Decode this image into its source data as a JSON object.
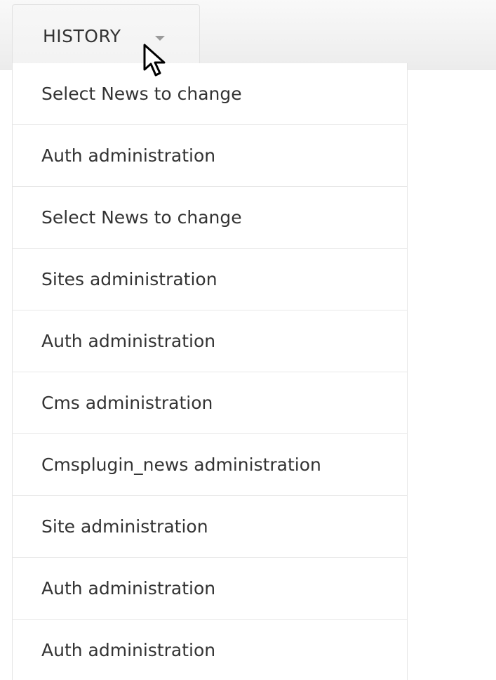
{
  "history_tab": {
    "label": "HISTORY",
    "caret_icon": "caret-down-icon"
  },
  "cursor_icon": "mouse-pointer-icon",
  "history_menu": {
    "items": [
      {
        "label": "Select News to change"
      },
      {
        "label": "Auth administration"
      },
      {
        "label": "Select News to change"
      },
      {
        "label": "Sites administration"
      },
      {
        "label": "Auth administration"
      },
      {
        "label": "Cms administration"
      },
      {
        "label": "Cmsplugin_news administration"
      },
      {
        "label": "Site administration"
      },
      {
        "label": "Auth administration"
      },
      {
        "label": "Auth administration"
      }
    ]
  }
}
